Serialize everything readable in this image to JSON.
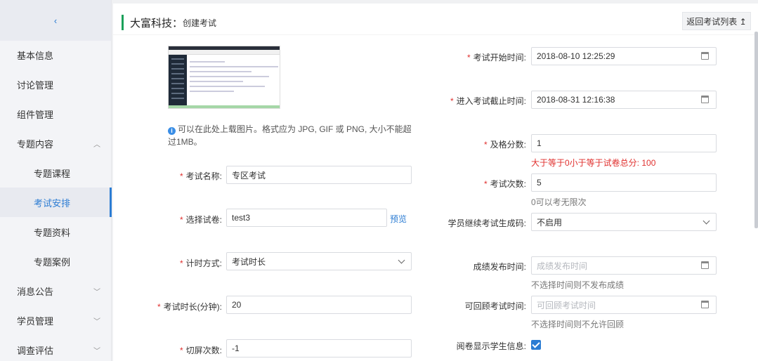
{
  "sidebar": {
    "collapse_glyph": "‹",
    "items": [
      {
        "label": "基本信息"
      },
      {
        "label": "讨论管理"
      },
      {
        "label": "组件管理"
      },
      {
        "label": "专题内容"
      },
      {
        "label": "专题课程"
      },
      {
        "label": "考试安排"
      },
      {
        "label": "专题资料"
      },
      {
        "label": "专题案例"
      },
      {
        "label": "消息公告"
      },
      {
        "label": "学员管理"
      },
      {
        "label": "调查评估"
      }
    ]
  },
  "header": {
    "title": "大富科技：",
    "subtitle": "创建考试",
    "back_label": "返回考试列表 ↥"
  },
  "upload": {
    "hint": "可以在此处上载图片。格式应为 JPG, GIF 或 PNG, 大小不能超过1MB。"
  },
  "form": {
    "exam_name": {
      "label": "考试名称:",
      "value": "专区考试"
    },
    "paper": {
      "label": "选择试卷:",
      "value": "test3",
      "preview_label": "预览"
    },
    "timing": {
      "label": "计时方式:",
      "value": "考试时长"
    },
    "duration": {
      "label": "考试时长(分钟):",
      "value": "20"
    },
    "switch_count": {
      "label": "切屏次数:",
      "value": "-1"
    },
    "start_time": {
      "label": "考试开始时间:",
      "value": "2018-08-10 12:25:29"
    },
    "end_time": {
      "label": "进入考试截止时间:",
      "value": "2018-08-31 12:16:38"
    },
    "pass_score": {
      "label": "及格分数:",
      "value": "1",
      "note": "大于等于0小于等于试卷总分: 100"
    },
    "attempts": {
      "label": "考试次数:",
      "value": "5",
      "note": "0可以考无限次"
    },
    "continue_code": {
      "label": "学员继续考试生成码:",
      "value": "不启用"
    },
    "publish_time": {
      "label": "成绩发布时间:",
      "placeholder": "成绩发布时间",
      "note": "不选择时间则不发布成绩"
    },
    "review_time": {
      "label": "可回顾考试时间:",
      "placeholder": "可回顾考试时间",
      "note": "不选择时间则不允许回顾"
    },
    "show_student": {
      "label": "阅卷显示学生信息:",
      "checked": true
    }
  },
  "colors": {
    "accent": "#2b7cd3",
    "title_bar": "#1aa05a",
    "required": "#e0302e"
  }
}
